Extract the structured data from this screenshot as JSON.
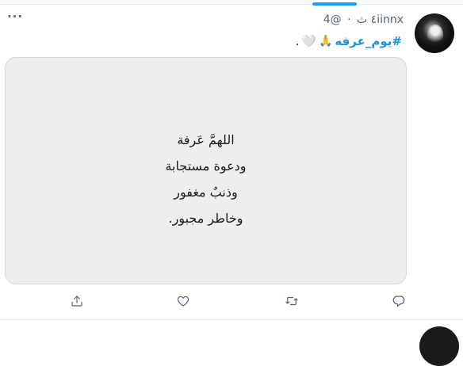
{
  "tweet": {
    "handle": "@4iinnx",
    "separator": "·",
    "time": "٤ ث",
    "text_period": ".",
    "text_heart": "🤍",
    "text_emoji": "🙏",
    "hashtag": "#يوم_عرفه",
    "more_label": "···"
  },
  "media": {
    "poem_lines": [
      "اللهمَّ عَرفة",
      "ودعوة مستجابة",
      "وذنبٌ مغفور",
      "وخاطر مجبور."
    ]
  },
  "actions": [
    {
      "icon": "share-icon"
    },
    {
      "icon": "like-icon"
    },
    {
      "icon": "retweet-icon"
    },
    {
      "icon": "reply-icon"
    }
  ],
  "colors": {
    "accent": "#1da1f2",
    "hashtag": "#1b95e0",
    "icon_gray": "#536471",
    "media_bg": "#eeeeee"
  }
}
